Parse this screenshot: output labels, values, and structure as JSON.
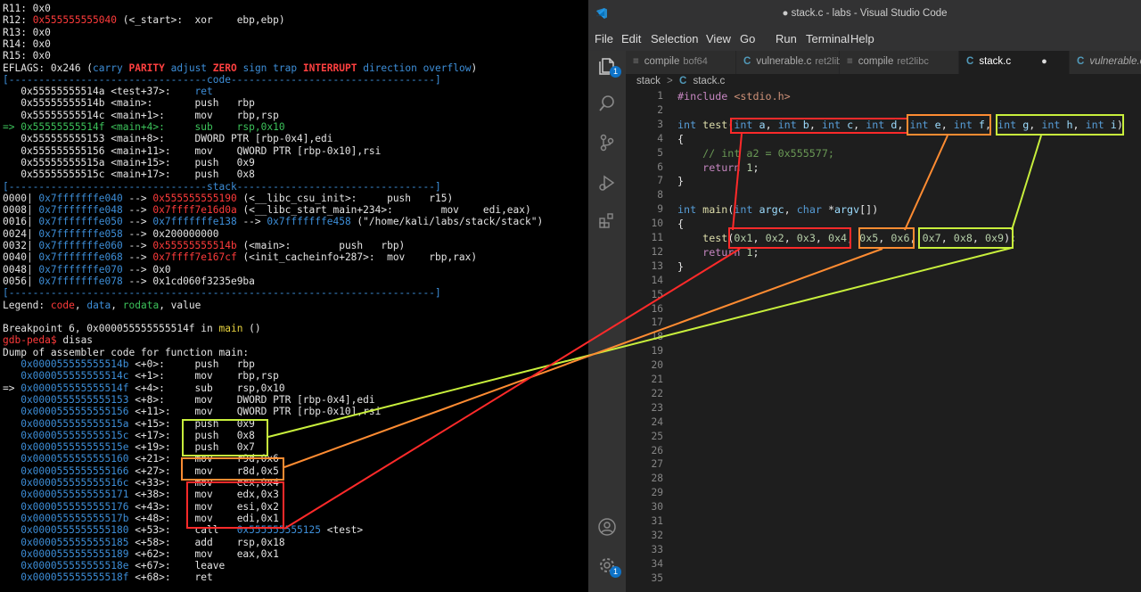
{
  "colors": {
    "red": "#ff2a2a",
    "orange": "#ff8c32",
    "lime": "#c8ef3c",
    "term_red": "#ff3b3b",
    "term_blue": "#3d8ed8",
    "vs_bg": "#1e1e1e"
  },
  "terminal": {
    "lines": [
      [
        {
          "t": "R11: 0x0",
          "c": "w"
        }
      ],
      [
        {
          "t": "R12: ",
          "c": "w"
        },
        {
          "t": "0x555555555040",
          "c": "r"
        },
        {
          "t": " (<_start>:  xor    ebp,ebp)",
          "c": "w"
        }
      ],
      [
        {
          "t": "R13: 0x0",
          "c": "w"
        }
      ],
      [
        {
          "t": "R14: 0x0",
          "c": "w"
        }
      ],
      [
        {
          "t": "R15: 0x0",
          "c": "w"
        }
      ],
      [
        {
          "t": "EFLAGS: 0x246 (",
          "c": "w"
        },
        {
          "t": "carry ",
          "c": "b"
        },
        {
          "t": "PARITY ",
          "c": "br"
        },
        {
          "t": "adjust ",
          "c": "b"
        },
        {
          "t": "ZERO ",
          "c": "br"
        },
        {
          "t": "sign ",
          "c": "b"
        },
        {
          "t": "trap ",
          "c": "b"
        },
        {
          "t": "INTERRUPT ",
          "c": "br"
        },
        {
          "t": "direction ",
          "c": "b"
        },
        {
          "t": "overflow",
          "c": "b"
        },
        {
          "t": ")",
          "c": "w"
        }
      ],
      [
        {
          "t": "[---------------------------------code----------------------------------]",
          "c": "b"
        }
      ],
      [
        {
          "t": "   0x55555555514a <test+37>:    ",
          "c": "w"
        },
        {
          "t": "ret",
          "c": "b"
        }
      ],
      [
        {
          "t": "   0x55555555514b <main>:       push   rbp",
          "c": "w"
        }
      ],
      [
        {
          "t": "   0x55555555514c <main+1>:     mov    rbp,rsp",
          "c": "w"
        }
      ],
      [
        {
          "t": "=> 0x55555555514f <main+4>:     sub    rsp,0x10",
          "c": "g"
        }
      ],
      [
        {
          "t": "   0x555555555153 <main+8>:     DWORD PTR [rbp-0x4],edi",
          "c": "w"
        }
      ],
      [
        {
          "t": "   0x555555555156 <main+11>:    mov    QWORD PTR [rbp-0x10],rsi",
          "c": "w"
        }
      ],
      [
        {
          "t": "   0x55555555515a <main+15>:    push   0x9",
          "c": "w"
        }
      ],
      [
        {
          "t": "   0x55555555515c <main+17>:    push   0x8",
          "c": "w"
        }
      ],
      [
        {
          "t": "[---------------------------------stack---------------------------------]",
          "c": "b"
        }
      ],
      [
        {
          "t": "0000| ",
          "c": "w"
        },
        {
          "t": "0x7fffffffe040",
          "c": "b"
        },
        {
          "t": " --> ",
          "c": "w"
        },
        {
          "t": "0x555555555190",
          "c": "r"
        },
        {
          "t": " (<__libc_csu_init>:     push   r15)",
          "c": "w"
        }
      ],
      [
        {
          "t": "0008| ",
          "c": "w"
        },
        {
          "t": "0x7fffffffe048",
          "c": "b"
        },
        {
          "t": " --> ",
          "c": "w"
        },
        {
          "t": "0x7ffff7e16d0a",
          "c": "r"
        },
        {
          "t": " (<__libc_start_main+234>:        mov    edi,eax)",
          "c": "w"
        }
      ],
      [
        {
          "t": "0016| ",
          "c": "w"
        },
        {
          "t": "0x7fffffffe050",
          "c": "b"
        },
        {
          "t": " --> ",
          "c": "w"
        },
        {
          "t": "0x7fffffffe138",
          "c": "b"
        },
        {
          "t": " --> ",
          "c": "w"
        },
        {
          "t": "0x7fffffffe458",
          "c": "b"
        },
        {
          "t": " (\"/home/kali/labs/stack/stack\")",
          "c": "w"
        }
      ],
      [
        {
          "t": "0024| ",
          "c": "w"
        },
        {
          "t": "0x7fffffffe058",
          "c": "b"
        },
        {
          "t": " --> 0x200000000",
          "c": "w"
        }
      ],
      [
        {
          "t": "0032| ",
          "c": "w"
        },
        {
          "t": "0x7fffffffe060",
          "c": "b"
        },
        {
          "t": " --> ",
          "c": "w"
        },
        {
          "t": "0x55555555514b",
          "c": "r"
        },
        {
          "t": " (<main>:        push   rbp)",
          "c": "w"
        }
      ],
      [
        {
          "t": "0040| ",
          "c": "w"
        },
        {
          "t": "0x7fffffffe068",
          "c": "b"
        },
        {
          "t": " --> ",
          "c": "w"
        },
        {
          "t": "0x7ffff7e167cf",
          "c": "r"
        },
        {
          "t": " (<init_cacheinfo+287>:  mov    rbp,rax)",
          "c": "w"
        }
      ],
      [
        {
          "t": "0048| ",
          "c": "w"
        },
        {
          "t": "0x7fffffffe070",
          "c": "b"
        },
        {
          "t": " --> 0x0",
          "c": "w"
        }
      ],
      [
        {
          "t": "0056| ",
          "c": "w"
        },
        {
          "t": "0x7fffffffe078",
          "c": "b"
        },
        {
          "t": " --> 0x1cd060f3235e9ba",
          "c": "w"
        }
      ],
      [
        {
          "t": "[-----------------------------------------------------------------------]",
          "c": "b"
        }
      ],
      [
        {
          "t": "Legend: ",
          "c": "w"
        },
        {
          "t": "code",
          "c": "r"
        },
        {
          "t": ", ",
          "c": "w"
        },
        {
          "t": "data",
          "c": "b"
        },
        {
          "t": ", ",
          "c": "w"
        },
        {
          "t": "rodata",
          "c": "g"
        },
        {
          "t": ", value",
          "c": "w"
        }
      ],
      [
        {
          "t": "",
          "c": "w"
        }
      ],
      [
        {
          "t": "Breakpoint 6, 0x000055555555514f in ",
          "c": "w"
        },
        {
          "t": "main",
          "c": "y"
        },
        {
          "t": " ()",
          "c": "w"
        }
      ],
      [
        {
          "t": "gdb-peda$ ",
          "c": "r"
        },
        {
          "t": "disas",
          "c": "w"
        }
      ],
      [
        {
          "t": "Dump of assembler code for function main:",
          "c": "w"
        }
      ],
      [
        {
          "t": "   0x000055555555514b",
          "c": "b"
        },
        {
          "t": " <+0>:     push   rbp",
          "c": "w"
        }
      ],
      [
        {
          "t": "   0x000055555555514c",
          "c": "b"
        },
        {
          "t": " <+1>:     mov    rbp,rsp",
          "c": "w"
        }
      ],
      [
        {
          "t": "=> ",
          "c": "w"
        },
        {
          "t": "0x000055555555514f",
          "c": "b"
        },
        {
          "t": " <+4>:     sub    rsp,0x10",
          "c": "w"
        }
      ],
      [
        {
          "t": "   0x0000555555555153",
          "c": "b"
        },
        {
          "t": " <+8>:     mov    DWORD PTR [rbp-0x4],edi",
          "c": "w"
        }
      ],
      [
        {
          "t": "   0x0000555555555156",
          "c": "b"
        },
        {
          "t": " <+11>:    mov    QWORD PTR [rbp-0x10],rsi",
          "c": "w"
        }
      ],
      [
        {
          "t": "   0x000055555555515a",
          "c": "b"
        },
        {
          "t": " <+15>:    push   0x9",
          "c": "w"
        }
      ],
      [
        {
          "t": "   0x000055555555515c",
          "c": "b"
        },
        {
          "t": " <+17>:    push   0x8",
          "c": "w"
        }
      ],
      [
        {
          "t": "   0x000055555555515e",
          "c": "b"
        },
        {
          "t": " <+19>:    push   0x7",
          "c": "w"
        }
      ],
      [
        {
          "t": "   0x0000555555555160",
          "c": "b"
        },
        {
          "t": " <+21>:    mov    r9d,0x6",
          "c": "w"
        }
      ],
      [
        {
          "t": "   0x0000555555555166",
          "c": "b"
        },
        {
          "t": " <+27>:    mov    r8d,0x5",
          "c": "w"
        }
      ],
      [
        {
          "t": "   0x000055555555516c",
          "c": "b"
        },
        {
          "t": " <+33>:    mov    ecx,0x4",
          "c": "w"
        }
      ],
      [
        {
          "t": "   0x0000555555555171",
          "c": "b"
        },
        {
          "t": " <+38>:    mov    edx,0x3",
          "c": "w"
        }
      ],
      [
        {
          "t": "   0x0000555555555176",
          "c": "b"
        },
        {
          "t": " <+43>:    mov    esi,0x2",
          "c": "w"
        }
      ],
      [
        {
          "t": "   0x000055555555517b",
          "c": "b"
        },
        {
          "t": " <+48>:    mov    edi,0x1",
          "c": "w"
        }
      ],
      [
        {
          "t": "   0x0000555555555180",
          "c": "b"
        },
        {
          "t": " <+53>:    call   ",
          "c": "w"
        },
        {
          "t": "0x555555555125",
          "c": "b"
        },
        {
          "t": " <test>",
          "c": "w"
        }
      ],
      [
        {
          "t": "   0x0000555555555185",
          "c": "b"
        },
        {
          "t": " <+58>:    add    rsp,0x18",
          "c": "w"
        }
      ],
      [
        {
          "t": "   0x0000555555555189",
          "c": "b"
        },
        {
          "t": " <+62>:    mov    eax,0x1",
          "c": "w"
        }
      ],
      [
        {
          "t": "   0x000055555555518e",
          "c": "b"
        },
        {
          "t": " <+67>:    leave",
          "c": "w"
        }
      ],
      [
        {
          "t": "   0x000055555555518f",
          "c": "b"
        },
        {
          "t": " <+68>:    ret",
          "c": "w"
        }
      ]
    ]
  },
  "vscode": {
    "title": "● stack.c - labs - Visual Studio Code",
    "menu": [
      "File",
      "Edit",
      "Selection",
      "View",
      "Go",
      "Run",
      "Terminal",
      "Help"
    ],
    "tabs": [
      {
        "icon": "≡",
        "name": "compile",
        "sub": "bof64",
        "active": false
      },
      {
        "icon": "C",
        "name": "vulnerable.c",
        "sub": "ret2libc",
        "active": false
      },
      {
        "icon": "≡",
        "name": "compile",
        "sub": "ret2libc",
        "active": false
      },
      {
        "icon": "C",
        "name": "stack.c",
        "sub": "●",
        "active": true
      },
      {
        "icon": "C",
        "name": "vulnerable.c",
        "sub": "",
        "active": false
      }
    ],
    "breadcrumb": {
      "folder": "stack",
      "sep": ">",
      "file_icon": "C",
      "file": "stack.c"
    },
    "activity_badges": [
      "1",
      "1"
    ],
    "line_numbers": [
      "1",
      "2",
      "3",
      "4",
      "5",
      "6",
      "7",
      "8",
      "9",
      "10",
      "11",
      "12",
      "13",
      "14",
      "15",
      "16",
      "17",
      "18",
      "19",
      "20",
      "21",
      "22",
      "23",
      "24",
      "25",
      "26",
      "27",
      "28",
      "29",
      "30",
      "31",
      "32",
      "33",
      "34",
      "35"
    ],
    "code_lines": [
      [
        {
          "t": "#include ",
          "c": "pp"
        },
        {
          "t": "<stdio.h>",
          "c": "st"
        }
      ],
      [],
      [
        {
          "t": "int ",
          "c": "kw"
        },
        {
          "t": "test",
          "c": "fn"
        },
        {
          "t": "(",
          "c": "w"
        },
        {
          "t": "int ",
          "c": "kw"
        },
        {
          "t": "a",
          "c": "pa"
        },
        {
          "t": ", ",
          "c": "w"
        },
        {
          "t": "int ",
          "c": "kw"
        },
        {
          "t": "b",
          "c": "pa"
        },
        {
          "t": ", ",
          "c": "w"
        },
        {
          "t": "int ",
          "c": "kw"
        },
        {
          "t": "c",
          "c": "pa"
        },
        {
          "t": ", ",
          "c": "w"
        },
        {
          "t": "int ",
          "c": "kw"
        },
        {
          "t": "d",
          "c": "pa"
        },
        {
          "t": ", ",
          "c": "w"
        },
        {
          "t": "int ",
          "c": "kw"
        },
        {
          "t": "e",
          "c": "pa"
        },
        {
          "t": ", ",
          "c": "w"
        },
        {
          "t": "int ",
          "c": "kw"
        },
        {
          "t": "f",
          "c": "pa"
        },
        {
          "t": ", ",
          "c": "w"
        },
        {
          "t": "int ",
          "c": "kw"
        },
        {
          "t": "g",
          "c": "pa"
        },
        {
          "t": ", ",
          "c": "w"
        },
        {
          "t": "int ",
          "c": "kw"
        },
        {
          "t": "h",
          "c": "pa"
        },
        {
          "t": ", ",
          "c": "w"
        },
        {
          "t": "int ",
          "c": "kw"
        },
        {
          "t": "i",
          "c": "pa"
        },
        {
          "t": ")",
          "c": "w"
        }
      ],
      [
        {
          "t": "{",
          "c": "w"
        }
      ],
      [
        {
          "t": "    // int a2 = 0x555577;",
          "c": "cm"
        }
      ],
      [
        {
          "t": "    ",
          "c": "w"
        },
        {
          "t": "return ",
          "c": "pp"
        },
        {
          "t": "1",
          "c": "nu"
        },
        {
          "t": ";",
          "c": "w"
        }
      ],
      [
        {
          "t": "}",
          "c": "w"
        }
      ],
      [],
      [
        {
          "t": "int ",
          "c": "kw"
        },
        {
          "t": "main",
          "c": "fn"
        },
        {
          "t": "(",
          "c": "w"
        },
        {
          "t": "int ",
          "c": "kw"
        },
        {
          "t": "argc",
          "c": "pa"
        },
        {
          "t": ", ",
          "c": "w"
        },
        {
          "t": "char ",
          "c": "kw"
        },
        {
          "t": "*",
          "c": "w"
        },
        {
          "t": "argv",
          "c": "pa"
        },
        {
          "t": "[])",
          "c": "w"
        }
      ],
      [
        {
          "t": "{",
          "c": "w"
        }
      ],
      [
        {
          "t": "    ",
          "c": "w"
        },
        {
          "t": "test",
          "c": "fn"
        },
        {
          "t": "(",
          "c": "w"
        },
        {
          "t": "0x1",
          "c": "nu"
        },
        {
          "t": ", ",
          "c": "w"
        },
        {
          "t": "0x2",
          "c": "nu"
        },
        {
          "t": ", ",
          "c": "w"
        },
        {
          "t": "0x3",
          "c": "nu"
        },
        {
          "t": ", ",
          "c": "w"
        },
        {
          "t": "0x4",
          "c": "nu"
        },
        {
          "t": ", ",
          "c": "w"
        },
        {
          "t": "0x5",
          "c": "nu"
        },
        {
          "t": ", ",
          "c": "w"
        },
        {
          "t": "0x6",
          "c": "nu"
        },
        {
          "t": ", ",
          "c": "w"
        },
        {
          "t": "0x7",
          "c": "nu"
        },
        {
          "t": ", ",
          "c": "w"
        },
        {
          "t": "0x8",
          "c": "nu"
        },
        {
          "t": ", ",
          "c": "w"
        },
        {
          "t": "0x9",
          "c": "nu"
        },
        {
          "t": ");",
          "c": "w"
        }
      ],
      [
        {
          "t": "    ",
          "c": "w"
        },
        {
          "t": "return ",
          "c": "pp"
        },
        {
          "t": "1",
          "c": "nu"
        },
        {
          "t": ";",
          "c": "w"
        }
      ],
      [
        {
          "t": "}",
          "c": "w"
        }
      ]
    ]
  }
}
